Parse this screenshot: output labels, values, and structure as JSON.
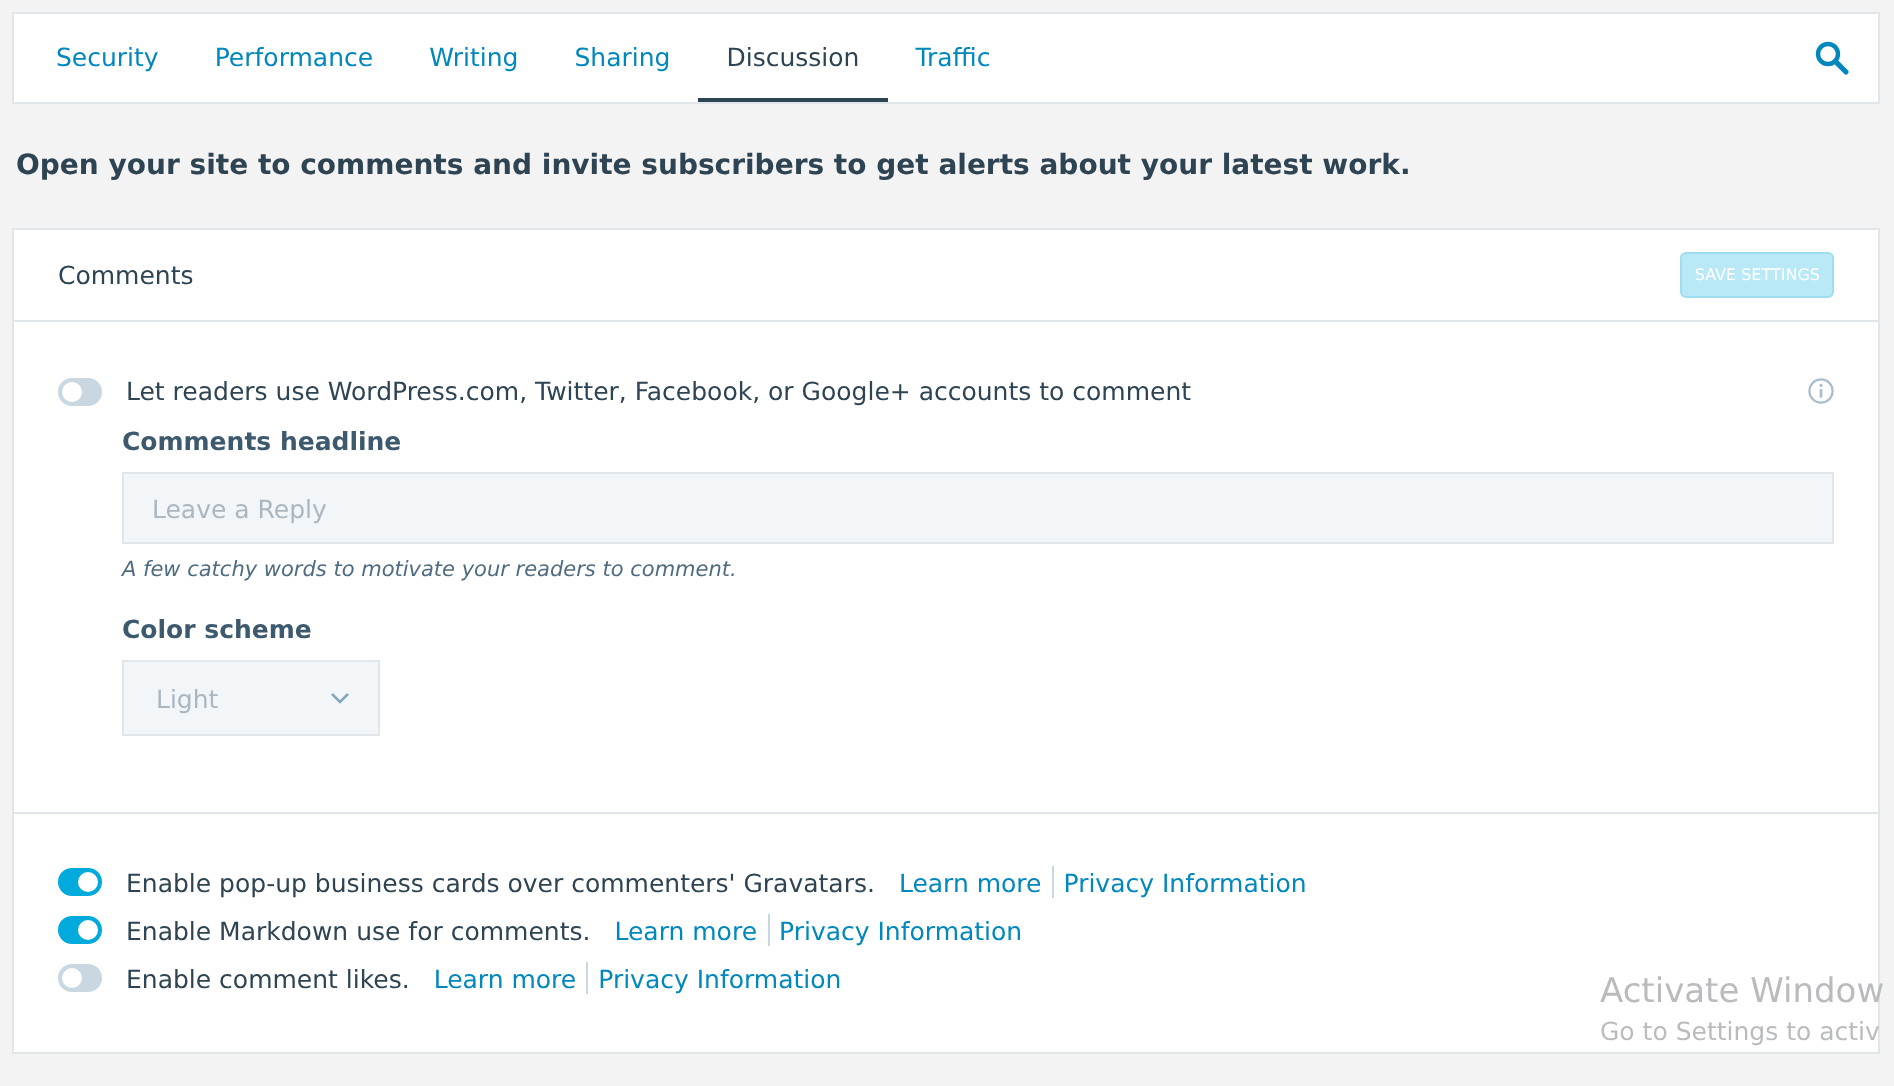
{
  "tabs": [
    {
      "label": "Security",
      "selected": false
    },
    {
      "label": "Performance",
      "selected": false
    },
    {
      "label": "Writing",
      "selected": false
    },
    {
      "label": "Sharing",
      "selected": false
    },
    {
      "label": "Discussion",
      "selected": true
    },
    {
      "label": "Traffic",
      "selected": false
    }
  ],
  "intro": "Open your site to comments and invite subscribers to get alerts about your latest work.",
  "card": {
    "title": "Comments",
    "save_button": {
      "label": "SAVE SETTINGS",
      "disabled": true
    },
    "social_login": {
      "label": "Let readers use WordPress.com, Twitter, Facebook, or Google+ accounts to comment",
      "on": false
    },
    "headline": {
      "label": "Comments headline",
      "placeholder": "Leave a Reply",
      "disabled": true,
      "hint": "A few catchy words to motivate your readers to comment."
    },
    "color_scheme": {
      "label": "Color scheme",
      "value": "Light",
      "disabled": true
    },
    "options": [
      {
        "label": "Enable pop-up business cards over commenters' Gravatars.",
        "on": true,
        "learn_more": "Learn more",
        "privacy": "Privacy Information"
      },
      {
        "label": "Enable Markdown use for comments.",
        "on": true,
        "learn_more": "Learn more",
        "privacy": "Privacy Information"
      },
      {
        "label": "Enable comment likes.",
        "on": false,
        "learn_more": "Learn more",
        "privacy": "Privacy Information"
      }
    ]
  },
  "activation_notice": {
    "title": "Activate Window",
    "subtitle": "Go to Settings to activ"
  }
}
